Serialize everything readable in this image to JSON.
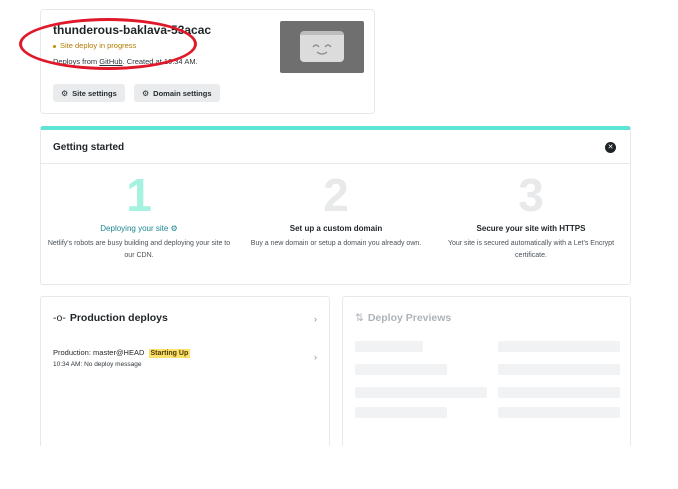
{
  "site": {
    "name": "thunderous-baklava-53acac",
    "status": "Site deploy in progress",
    "meta_prefix": "Deploys from ",
    "meta_link": "GitHub",
    "meta_suffix": ". Created at 10:34 AM.",
    "buttons": [
      {
        "label": "Site settings",
        "icon": "gear-icon"
      },
      {
        "label": "Domain settings",
        "icon": "gear-icon"
      }
    ]
  },
  "getting_started": {
    "title": "Getting started",
    "close_icon": "close-icon",
    "steps": [
      {
        "number": "1",
        "title": "Deploying your site",
        "description": "Netlify's robots are busy building and deploying your site to our CDN.",
        "active": true
      },
      {
        "number": "2",
        "title": "Set up a custom domain",
        "description": "Buy a new domain or setup a domain you already own.",
        "active": false
      },
      {
        "number": "3",
        "title": "Secure your site with HTTPS",
        "description": "Your site is secured automatically with a Let's Encrypt certificate.",
        "active": false
      }
    ]
  },
  "production": {
    "title": "Production deploys",
    "row_label": "Production: master@HEAD",
    "row_badge": "Starting Up",
    "row_meta": "10:34 AM: No deploy message"
  },
  "previews": {
    "title": "Deploy Previews"
  },
  "colors": {
    "accent": "#5ee5d5",
    "active_step": "#1b8792",
    "warning": "#b37b00",
    "badge": "#fbe16b",
    "annotation": "#e0182a"
  }
}
